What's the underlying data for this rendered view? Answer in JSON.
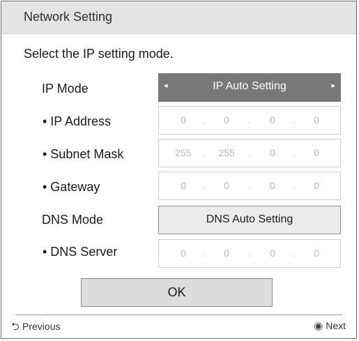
{
  "dialog": {
    "title": "Network Setting",
    "instruction": "Select the IP setting mode."
  },
  "ip_mode": {
    "label": "IP Mode",
    "value": "IP Auto Setting",
    "left_arrow": "◂",
    "right_arrow": "▸"
  },
  "ip_address": {
    "label": "• IP Address",
    "octets": [
      "0",
      "0",
      "0",
      "0"
    ]
  },
  "subnet_mask": {
    "label": "• Subnet Mask",
    "octets": [
      "255",
      "255",
      "0",
      "0"
    ]
  },
  "gateway": {
    "label": "• Gateway",
    "octets": [
      "0",
      "0",
      "0",
      "0"
    ]
  },
  "dns_mode": {
    "label": "DNS Mode",
    "value": "DNS Auto Setting"
  },
  "dns_server": {
    "label": "• DNS Server",
    "octets": [
      "0",
      "0",
      "0",
      "0"
    ]
  },
  "buttons": {
    "ok": "OK"
  },
  "footer": {
    "previous_icon": "⮌",
    "previous_label": "Previous",
    "next_icon": "◉",
    "next_label": "Next"
  },
  "separator": "."
}
